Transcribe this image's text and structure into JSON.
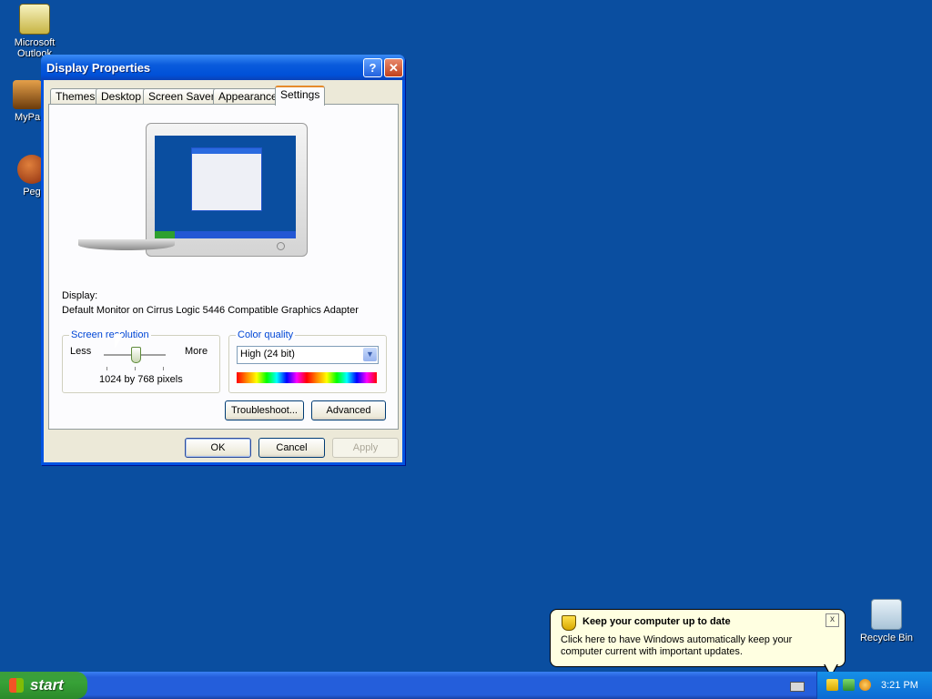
{
  "desktop": {
    "icons": [
      {
        "label": "Microsoft Outlook",
        "icon": "outlook-icon"
      },
      {
        "label": "MyPa",
        "icon": "mypal-icon"
      },
      {
        "label": "Peg",
        "icon": "pegasus-icon"
      },
      {
        "label": "Recycle Bin",
        "icon": "recycle-bin-icon"
      }
    ]
  },
  "window": {
    "title": "Display Properties",
    "help_symbol": "?",
    "close_symbol": "✕",
    "tabs": [
      "Themes",
      "Desktop",
      "Screen Saver",
      "Appearance",
      "Settings"
    ],
    "active_tab": "Settings",
    "display_label": "Display:",
    "display_value": "Default Monitor on Cirrus Logic 5446 Compatible Graphics Adapter",
    "screen_resolution": {
      "title": "Screen resolution",
      "less_label": "Less",
      "more_label": "More",
      "value_text": "1024 by 768 pixels"
    },
    "color_quality": {
      "title": "Color quality",
      "selected": "High (24 bit)",
      "arrow": "▼"
    },
    "buttons": {
      "troubleshoot": "Troubleshoot...",
      "advanced": "Advanced",
      "ok": "OK",
      "cancel": "Cancel",
      "apply": "Apply"
    }
  },
  "taskbar": {
    "start_label": "start",
    "clock": "3:21 PM"
  },
  "balloon": {
    "title": "Keep your computer up to date",
    "message": "Click here to have Windows automatically keep your computer current with important updates.",
    "close_symbol": "x"
  }
}
